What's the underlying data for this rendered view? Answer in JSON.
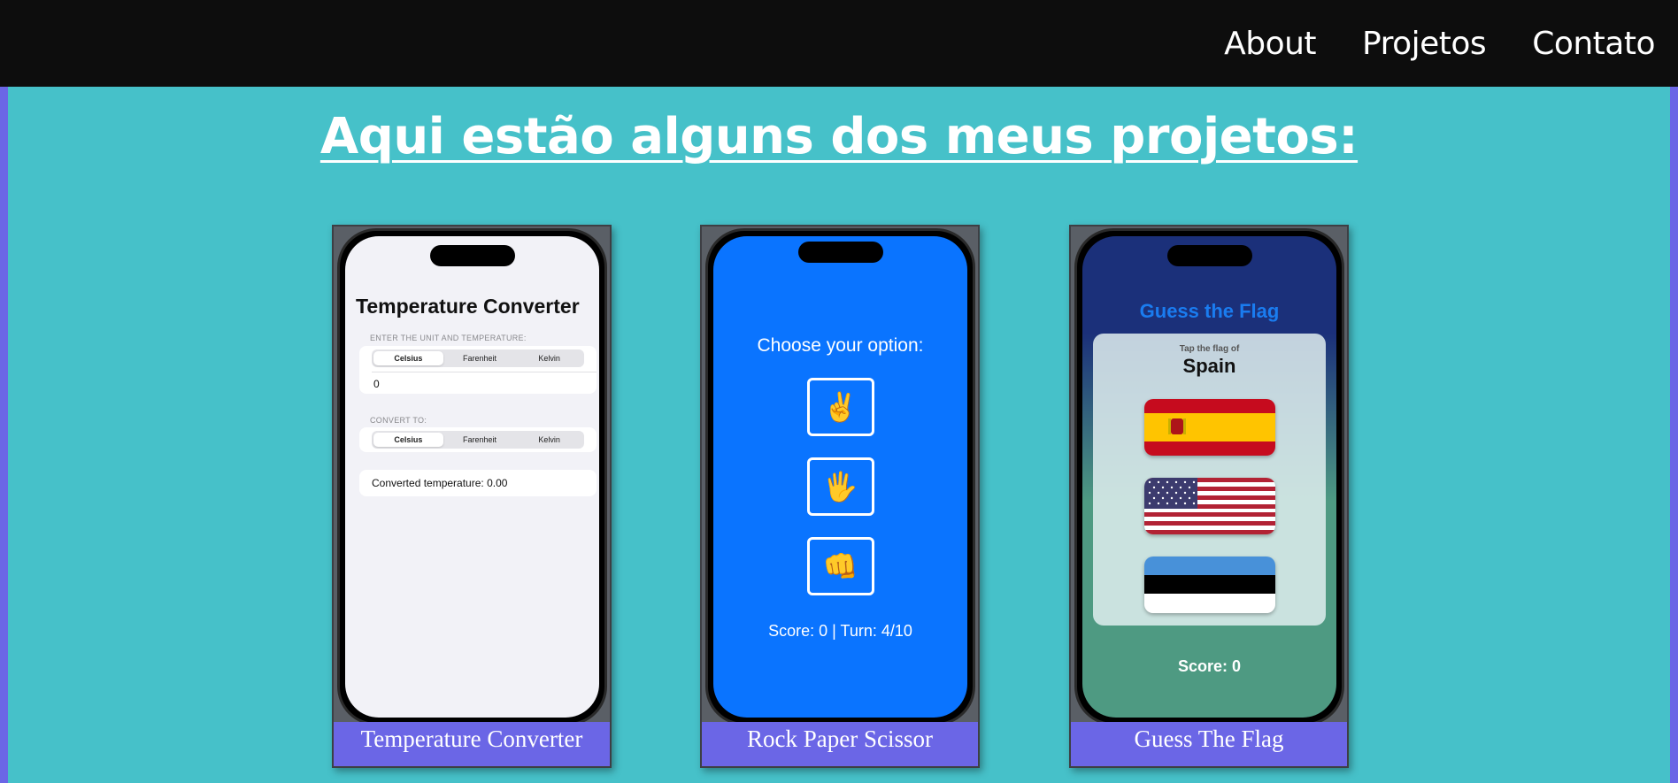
{
  "nav": {
    "links": [
      "About",
      "Projetos",
      "Contato"
    ]
  },
  "heading": "Aqui estão alguns dos meus projetos:",
  "colors": {
    "background": "#46c1c9",
    "navbar": "#0d0d0d",
    "caption": "#6b66e6",
    "rps_blue": "#0a74ff",
    "flag_title": "#1a7cf0"
  },
  "projects": [
    {
      "caption": "Temperature Converter",
      "app": {
        "title": "Temperature Converter",
        "section1_label": "ENTER THE UNIT AND TEMPERATURE:",
        "units": [
          "Celsius",
          "Farenheit",
          "Kelvin"
        ],
        "input_value": "0",
        "section2_label": "CONVERT TO:",
        "result": "Converted temperature: 0.00"
      }
    },
    {
      "caption": "Rock Paper Scissor",
      "app": {
        "prompt": "Choose your option:",
        "options": [
          "✌️",
          "🖐️",
          "👊"
        ],
        "score": "Score: 0 | Turn: 4/10"
      }
    },
    {
      "caption": "Guess The Flag",
      "app": {
        "title": "Guess the Flag",
        "subtitle": "Tap the flag of",
        "country": "Spain",
        "flags": [
          "spain-flag",
          "usa-flag",
          "estonia-flag"
        ],
        "score": "Score: 0"
      }
    }
  ]
}
